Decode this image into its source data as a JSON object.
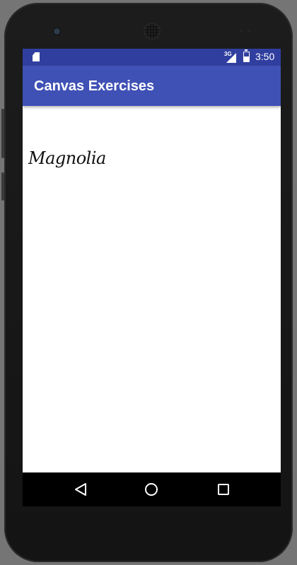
{
  "status_bar": {
    "network_type": "3G",
    "time": "3:50",
    "battery_level": 0.55
  },
  "app_bar": {
    "title": "Canvas Exercises",
    "color": "#3f51b5"
  },
  "status_bar_color": "#303f9f",
  "canvas": {
    "text": "Magnolia"
  },
  "nav_bar": {
    "buttons": [
      "back-icon",
      "home-icon",
      "recents-icon"
    ]
  }
}
